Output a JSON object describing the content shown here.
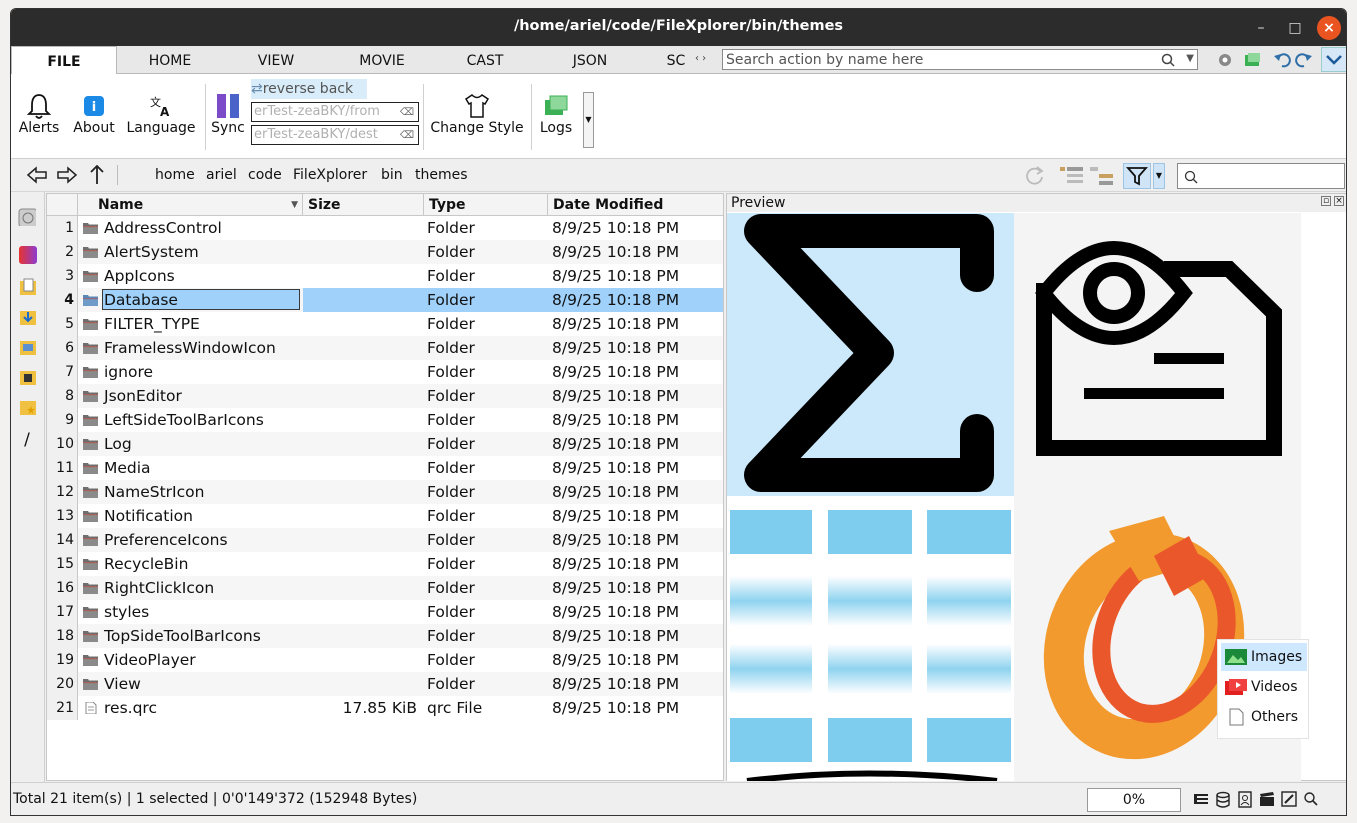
{
  "window": {
    "title": "/home/ariel/code/FileXplorer/bin/themes",
    "minimize": "–",
    "maximize": "□",
    "close": "×"
  },
  "tabs": [
    {
      "label": "FILE",
      "active": true
    },
    {
      "label": "HOME"
    },
    {
      "label": "VIEW"
    },
    {
      "label": "MOVIE"
    },
    {
      "label": "CAST"
    },
    {
      "label": "JSON"
    },
    {
      "label": "SC"
    }
  ],
  "search_action": {
    "placeholder": "Search action by name here"
  },
  "ribbon": {
    "alerts": "Alerts",
    "about": "About",
    "language": "Language",
    "sync": "Sync",
    "reverse_back": "reverse back",
    "from_path": "erTest-zeaBKY/from",
    "dest_path": "erTest-zeaBKY/dest",
    "change_style": "Change Style",
    "logs": "Logs"
  },
  "breadcrumb": [
    "home",
    "ariel",
    "code",
    "FileXplorer",
    "bin",
    "themes"
  ],
  "table": {
    "headers": {
      "name": "Name",
      "size": "Size",
      "type": "Type",
      "date": "Date Modified"
    },
    "rows": [
      {
        "n": "1",
        "name": "AddressControl",
        "size": "",
        "type": "Folder",
        "date": "8/9/25 10:18 PM"
      },
      {
        "n": "2",
        "name": "AlertSystem",
        "size": "",
        "type": "Folder",
        "date": "8/9/25 10:18 PM"
      },
      {
        "n": "3",
        "name": "AppIcons",
        "size": "",
        "type": "Folder",
        "date": "8/9/25 10:18 PM"
      },
      {
        "n": "4",
        "name": "Database",
        "size": "",
        "type": "Folder",
        "date": "8/9/25 10:18 PM",
        "selected": true
      },
      {
        "n": "5",
        "name": "FILTER_TYPE",
        "size": "",
        "type": "Folder",
        "date": "8/9/25 10:18 PM"
      },
      {
        "n": "6",
        "name": "FramelessWindowIcon",
        "size": "",
        "type": "Folder",
        "date": "8/9/25 10:18 PM"
      },
      {
        "n": "7",
        "name": "ignore",
        "size": "",
        "type": "Folder",
        "date": "8/9/25 10:18 PM"
      },
      {
        "n": "8",
        "name": "JsonEditor",
        "size": "",
        "type": "Folder",
        "date": "8/9/25 10:18 PM"
      },
      {
        "n": "9",
        "name": "LeftSideToolBarIcons",
        "size": "",
        "type": "Folder",
        "date": "8/9/25 10:18 PM"
      },
      {
        "n": "10",
        "name": "Log",
        "size": "",
        "type": "Folder",
        "date": "8/9/25 10:18 PM"
      },
      {
        "n": "11",
        "name": "Media",
        "size": "",
        "type": "Folder",
        "date": "8/9/25 10:18 PM"
      },
      {
        "n": "12",
        "name": "NameStrIcon",
        "size": "",
        "type": "Folder",
        "date": "8/9/25 10:18 PM"
      },
      {
        "n": "13",
        "name": "Notification",
        "size": "",
        "type": "Folder",
        "date": "8/9/25 10:18 PM"
      },
      {
        "n": "14",
        "name": "PreferenceIcons",
        "size": "",
        "type": "Folder",
        "date": "8/9/25 10:18 PM"
      },
      {
        "n": "15",
        "name": "RecycleBin",
        "size": "",
        "type": "Folder",
        "date": "8/9/25 10:18 PM"
      },
      {
        "n": "16",
        "name": "RightClickIcon",
        "size": "",
        "type": "Folder",
        "date": "8/9/25 10:18 PM"
      },
      {
        "n": "17",
        "name": "styles",
        "size": "",
        "type": "Folder",
        "date": "8/9/25 10:18 PM"
      },
      {
        "n": "18",
        "name": "TopSideToolBarIcons",
        "size": "",
        "type": "Folder",
        "date": "8/9/25 10:18 PM"
      },
      {
        "n": "19",
        "name": "VideoPlayer",
        "size": "",
        "type": "Folder",
        "date": "8/9/25 10:18 PM"
      },
      {
        "n": "20",
        "name": "View",
        "size": "",
        "type": "Folder",
        "date": "8/9/25 10:18 PM"
      },
      {
        "n": "21",
        "name": "res.qrc",
        "size": "17.85 KiB",
        "type": "qrc File",
        "date": "8/9/25 10:18 PM",
        "file": true
      }
    ]
  },
  "preview": {
    "title": "Preview",
    "legend": [
      {
        "label": "Images",
        "active": true,
        "icon": "image-icon"
      },
      {
        "label": "Videos",
        "icon": "video-icon"
      },
      {
        "label": "Others",
        "icon": "file-icon"
      }
    ]
  },
  "status": {
    "text": "Total 21 item(s) |  1 selected |  0'0'149'372 (152948 Bytes)",
    "zoom": "0%"
  },
  "colors": {
    "titlebar": "#2c2c2c",
    "close": "#e95420",
    "selection": "#9fd1fb",
    "accent": "#2f7fc1",
    "orange": "#f29a2e"
  }
}
